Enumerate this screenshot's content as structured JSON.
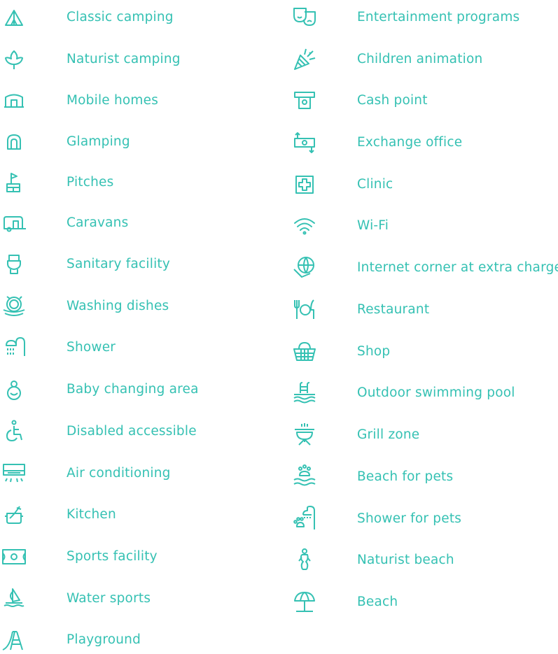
{
  "accent_color": "#35c1b3",
  "left_column": [
    {
      "icon": "tent-icon",
      "label": "Classic camping"
    },
    {
      "icon": "leaf-icon",
      "label": "Naturist camping"
    },
    {
      "icon": "mobile-home-icon",
      "label": "Mobile homes"
    },
    {
      "icon": "glamping-tent-icon",
      "label": "Glamping"
    },
    {
      "icon": "pitch-flag-icon",
      "label": "Pitches"
    },
    {
      "icon": "caravan-icon",
      "label": "Caravans"
    },
    {
      "icon": "toilet-icon",
      "label": "Sanitary facility"
    },
    {
      "icon": "dish-washing-icon",
      "label": "Washing dishes"
    },
    {
      "icon": "shower-icon",
      "label": "Shower"
    },
    {
      "icon": "baby-icon",
      "label": "Baby changing area"
    },
    {
      "icon": "wheelchair-icon",
      "label": "Disabled accessible"
    },
    {
      "icon": "air-conditioner-icon",
      "label": "Air conditioning"
    },
    {
      "icon": "cooking-pot-icon",
      "label": "Kitchen"
    },
    {
      "icon": "sports-field-icon",
      "label": "Sports facility"
    },
    {
      "icon": "sailboat-icon",
      "label": "Water sports"
    },
    {
      "icon": "slide-icon",
      "label": "Playground"
    }
  ],
  "right_column": [
    {
      "icon": "theater-masks-icon",
      "label": "Entertainment programs"
    },
    {
      "icon": "party-popper-icon",
      "label": "Children animation"
    },
    {
      "icon": "atm-icon",
      "label": "Cash point"
    },
    {
      "icon": "currency-exchange-icon",
      "label": "Exchange office"
    },
    {
      "icon": "medical-cross-icon",
      "label": "Clinic"
    },
    {
      "icon": "wifi-icon",
      "label": "Wi-Fi"
    },
    {
      "icon": "globe-pc-icon",
      "label": "Internet corner at extra charge"
    },
    {
      "icon": "restaurant-icon",
      "label": "Restaurant"
    },
    {
      "icon": "shopping-basket-icon",
      "label": "Shop"
    },
    {
      "icon": "swimming-pool-icon",
      "label": "Outdoor swimming pool"
    },
    {
      "icon": "grill-icon",
      "label": "Grill zone"
    },
    {
      "icon": "pet-beach-icon",
      "label": "Beach for pets"
    },
    {
      "icon": "pet-shower-icon",
      "label": "Shower for pets"
    },
    {
      "icon": "naturist-beach-icon",
      "label": "Naturist beach"
    },
    {
      "icon": "beach-umbrella-icon",
      "label": "Beach"
    }
  ]
}
